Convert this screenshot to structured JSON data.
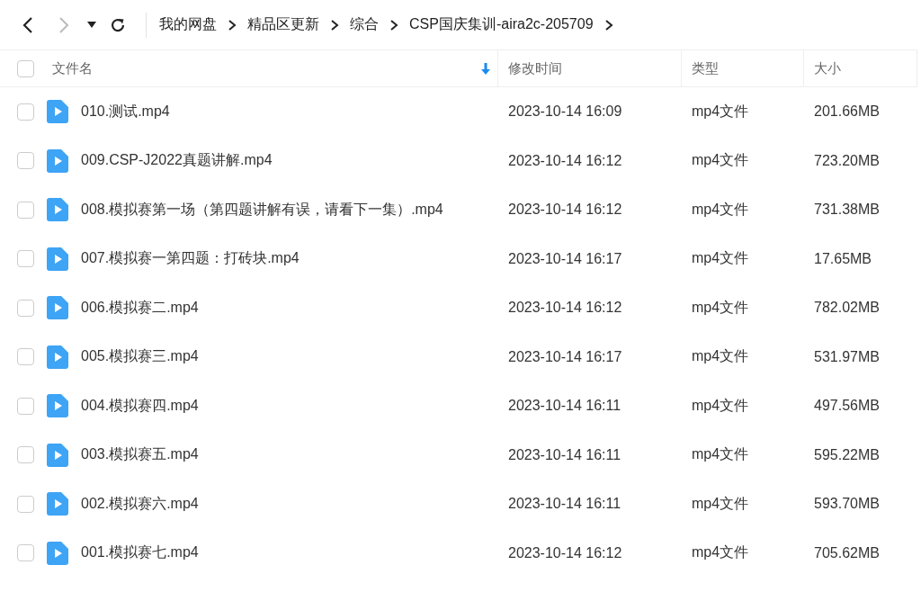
{
  "navigation": {
    "back_disabled": false,
    "forward_disabled": true
  },
  "breadcrumb": [
    "我的网盘",
    "精品区更新",
    "综合",
    "CSP国庆集训-aira2c-205709"
  ],
  "table": {
    "select_all_checked": false,
    "columns": [
      {
        "label": "文件名",
        "sorted": true
      },
      {
        "label": "修改时间",
        "sorted": false
      },
      {
        "label": "类型",
        "sorted": false
      },
      {
        "label": "大小",
        "sorted": false
      }
    ],
    "rows": [
      {
        "name": "010.测试.mp4",
        "modified": "2023-10-14 16:09",
        "type": "mp4文件",
        "size": "201.66MB",
        "checked": false
      },
      {
        "name": "009.CSP-J2022真题讲解.mp4",
        "modified": "2023-10-14 16:12",
        "type": "mp4文件",
        "size": "723.20MB",
        "checked": false
      },
      {
        "name": "008.模拟赛第一场（第四题讲解有误，请看下一集）.mp4",
        "modified": "2023-10-14 16:12",
        "type": "mp4文件",
        "size": "731.38MB",
        "checked": false
      },
      {
        "name": "007.模拟赛一第四题：打砖块.mp4",
        "modified": "2023-10-14 16:17",
        "type": "mp4文件",
        "size": "17.65MB",
        "checked": false
      },
      {
        "name": "006.模拟赛二.mp4",
        "modified": "2023-10-14 16:12",
        "type": "mp4文件",
        "size": "782.02MB",
        "checked": false
      },
      {
        "name": "005.模拟赛三.mp4",
        "modified": "2023-10-14 16:17",
        "type": "mp4文件",
        "size": "531.97MB",
        "checked": false
      },
      {
        "name": "004.模拟赛四.mp4",
        "modified": "2023-10-14 16:11",
        "type": "mp4文件",
        "size": "497.56MB",
        "checked": false
      },
      {
        "name": "003.模拟赛五.mp4",
        "modified": "2023-10-14 16:11",
        "type": "mp4文件",
        "size": "595.22MB",
        "checked": false
      },
      {
        "name": "002.模拟赛六.mp4",
        "modified": "2023-10-14 16:11",
        "type": "mp4文件",
        "size": "593.70MB",
        "checked": false
      },
      {
        "name": "001.模拟赛七.mp4",
        "modified": "2023-10-14 16:12",
        "type": "mp4文件",
        "size": "705.62MB",
        "checked": false
      }
    ]
  }
}
